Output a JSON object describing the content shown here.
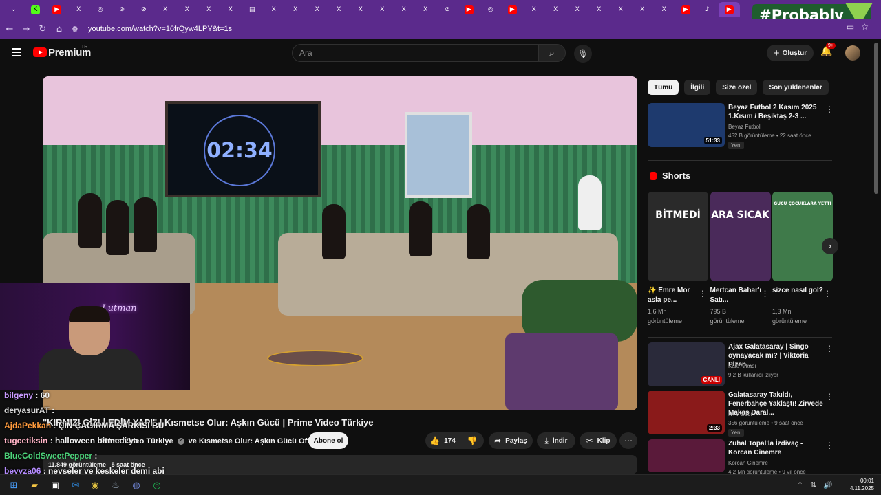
{
  "browser": {
    "tabs": [
      "⌄",
      "K",
      "▶",
      "X",
      "◎",
      "⊘",
      "⊘",
      "X",
      "X",
      "X",
      "X",
      "▤",
      "X",
      "X",
      "X",
      "X",
      "X",
      "X",
      "X",
      "X",
      "⊘",
      "▶",
      "◎",
      "▶",
      "X",
      "X",
      "X",
      "X",
      "X",
      "X",
      "X",
      "▶",
      "♪",
      "▶"
    ],
    "url": "youtube.com/watch?v=16frQyw4LPY&t=1s",
    "overlay_brand": "#Probably"
  },
  "masthead": {
    "logo_text": "Premium",
    "logo_country": "TR",
    "search_placeholder": "Ara",
    "create_label": "Oluştur",
    "notification_count": "9+"
  },
  "player": {
    "timer_text": "02:34",
    "neon_sign": "Lutman"
  },
  "chat": [
    {
      "user": "bilgeny",
      "message": ": 60",
      "color": "#c99aff"
    },
    {
      "user": "deryasurAT",
      "message": ":",
      "color": "#d8d8d8"
    },
    {
      "user": "AjdaPekkan",
      "message": ": ÇİN ÇAĞIRMA ŞARKISI BU",
      "color": "#ff9a3c"
    },
    {
      "user": "tugcetiksin",
      "message": ": halloween bitmedi.ya",
      "color": "#ffb3c6"
    },
    {
      "user": "BlueColdSweetPepper",
      "message": ":",
      "color": "#4cd37a"
    },
    {
      "user": "beyyza06",
      "message": ": neyseler ve keşkeler demi abi",
      "color": "#b58cff"
    }
  ],
  "video": {
    "title": "\"KIRMIZI GİZLİ EDİM YAPI\" | Kısmetse Olur: Aşkın Gücü | Prime Video Türkiye",
    "channel_line_1": "Prime Video Türkiye",
    "channel_line_2": "ve Kısmetse Olur: Aşkın Gücü Official",
    "subscribe": "Abone ol",
    "likes": "174",
    "share": "Paylaş",
    "download": "İndir",
    "clip": "Klip",
    "views": "11.849 görüntüleme",
    "posted": "5 saat önce"
  },
  "sidebar": {
    "chips": [
      "Tümü",
      "İlgili",
      "Size özel",
      "Son yüklenenler"
    ],
    "recommendations": [
      {
        "title": "Beyaz Futbol 2 Kasım 2025 1.Kısım / Beşiktaş 2-3 ...",
        "channel": "Beyaz Futbol",
        "meta": "452 B görüntüleme • 22 saat önce",
        "badge": "Yeni",
        "duration": "51:33",
        "thumb_color": "#1e3a6e"
      }
    ],
    "shorts_title": "Shorts",
    "shorts": [
      {
        "title": "✨ Emre Mor asla pe...",
        "views": "1,6 Mn",
        "views_label": "görüntüleme",
        "thumb_text": "BİTMEDİ",
        "thumb_color": "#2a2a2a"
      },
      {
        "title": "Mertcan Bahar'ı Satı...",
        "views": "795 B",
        "views_label": "görüntüleme",
        "thumb_text": "ARA SICAK",
        "thumb_color": "#4a2a5a"
      },
      {
        "title": "sizce nasıl gol?",
        "views": "1,3 Mn",
        "views_label": "görüntüleme",
        "thumb_text": "GÜCÜ ÇOCUKLARA YETTİ",
        "thumb_color": "#3f7a4a"
      }
    ],
    "more_recommendations": [
      {
        "title": "Ajax Galatasaray | Singo oynayacak mı? | Viktoria Plzen...",
        "channel": "Kale Arkası",
        "meta": "9,2 B kullanıcı izliyor",
        "badge": "",
        "duration": "",
        "live": "CANLI",
        "thumb_color": "#2a2a3a"
      },
      {
        "title": "Galatasaray Takıldı, Fenerbahçe Yaklaştı! Zirvede Makas Daral...",
        "channel": "NTV Spor",
        "meta": "356 görüntüleme • 9 saat önce",
        "badge": "Yeni",
        "duration": "2:33",
        "live": "",
        "thumb_color": "#8a1a1a"
      },
      {
        "title": "Zuhal Topal'la İzdivaç - Korcan Cinemre",
        "channel": "Korcan Cinemre",
        "meta": "4,2 Mn görüntüleme • 9 yıl önce",
        "badge": "",
        "duration": "",
        "live": "",
        "thumb_color": "#5a1a3a"
      }
    ]
  },
  "taskbar": {
    "time": "00:01",
    "date": "4.11.2025"
  }
}
